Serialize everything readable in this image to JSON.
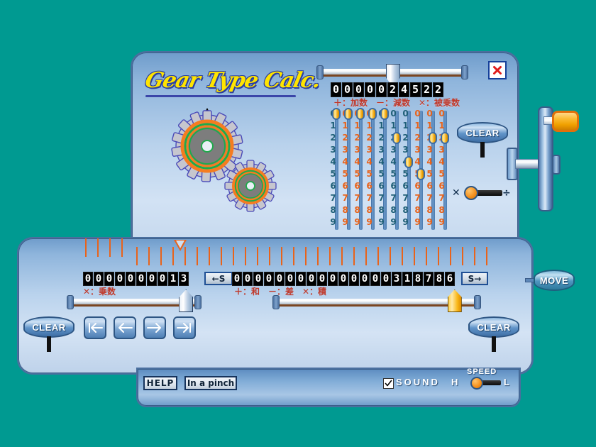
{
  "app": {
    "title": "Gear Type Calc.",
    "background_color": "#009a91",
    "accent_orange": "#e8631b",
    "accent_yellow": "#ffe400",
    "panel_blue": "#6f9ccb"
  },
  "window_controls": {
    "close_label": "✕",
    "close_icon": "close-icon"
  },
  "top_section": {
    "readout_digits": [
      "0",
      "0",
      "0",
      "0",
      "0",
      "2",
      "4",
      "5",
      "2",
      "2"
    ],
    "legend": "＋：加数　－：減数　✕：被乗数",
    "slider": {
      "name": "carriage-slider",
      "position_percent": 50
    },
    "clear_label": "CLEAR"
  },
  "matrix": {
    "rows": [
      "0",
      "1",
      "2",
      "3",
      "4",
      "5",
      "6",
      "7",
      "8",
      "9"
    ],
    "columns": [
      {
        "index": 0,
        "color": "teal",
        "selected": 0
      },
      {
        "index": 1,
        "color": "orange",
        "selected": 0
      },
      {
        "index": 2,
        "color": "orange",
        "selected": 0
      },
      {
        "index": 3,
        "color": "orange",
        "selected": 0
      },
      {
        "index": 4,
        "color": "teal",
        "selected": 0
      },
      {
        "index": 5,
        "color": "teal",
        "selected": 2
      },
      {
        "index": 6,
        "color": "teal",
        "selected": 4
      },
      {
        "index": 7,
        "color": "orange",
        "selected": 5
      },
      {
        "index": 8,
        "color": "orange",
        "selected": 2
      },
      {
        "index": 9,
        "color": "orange",
        "selected": 2
      }
    ]
  },
  "operator_slider": {
    "left_symbol": "✕",
    "right_symbol": "÷",
    "selected": "✕"
  },
  "crank": {
    "name": "crank-wheel",
    "handle_color": "#f0a000"
  },
  "move_button": {
    "label": "MOVE"
  },
  "bottom_section": {
    "left_readout_digits": [
      "0",
      "0",
      "0",
      "0",
      "0",
      "0",
      "0",
      "0",
      "1",
      "3"
    ],
    "left_legend": "✕：乗数",
    "right_readout_digits": [
      "0",
      "0",
      "0",
      "0",
      "0",
      "0",
      "0",
      "0",
      "0",
      "0",
      "0",
      "0",
      "0",
      "0",
      "0",
      "3",
      "1",
      "8",
      "7",
      "8",
      "6"
    ],
    "right_legend": "＋：和　－：差　✕：積",
    "shift_left_label": "←S",
    "shift_right_label": "S→",
    "clear_left_label": "CLEAR",
    "clear_right_label": "CLEAR",
    "arrow_buttons": [
      {
        "name": "move-to-start-button",
        "glyph": "|←"
      },
      {
        "name": "move-left-button",
        "glyph": "←"
      },
      {
        "name": "move-right-button",
        "glyph": "→"
      },
      {
        "name": "move-to-end-button",
        "glyph": "→|"
      }
    ],
    "slider_left": {
      "name": "multiplier-slider",
      "position_percent": 93
    },
    "slider_right": {
      "name": "result-slider",
      "position_percent": 90
    }
  },
  "bottom_bar": {
    "help_label": "HELP",
    "pinch_label": "In a pinch",
    "sound_label": "SOUND",
    "sound_checked": true,
    "sound_check_glyph": "✔",
    "speed_label": "SPEED",
    "speed_high": "H",
    "speed_low": "L",
    "speed_position_percent": 15
  }
}
